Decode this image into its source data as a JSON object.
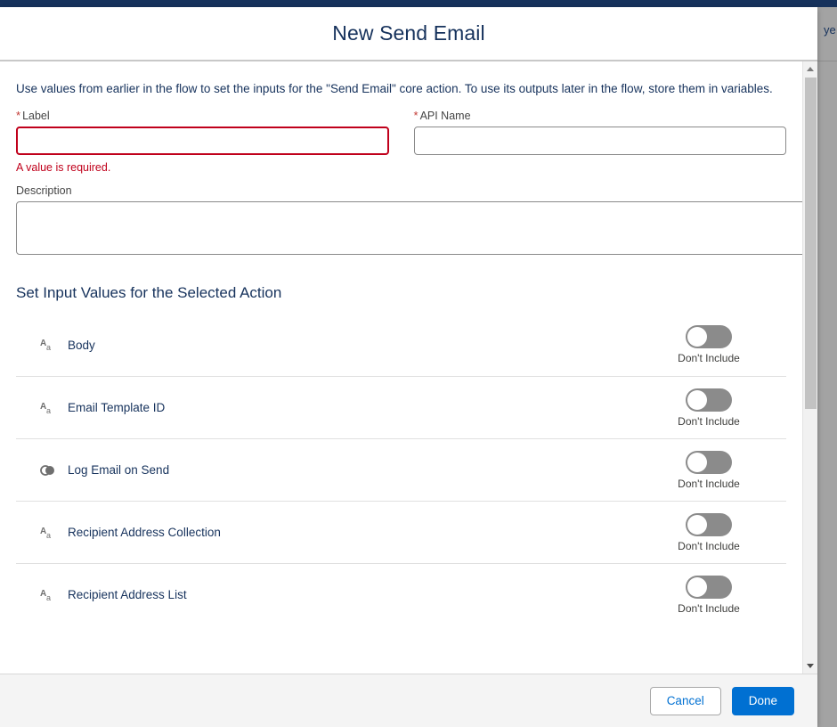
{
  "background": {
    "partial_text": "ye",
    "top_bar_color": "#16325c"
  },
  "modal": {
    "title": "New Send Email",
    "intro": "Use values from earlier in the flow to set the inputs for the \"Send Email\" core action. To use its outputs later in the flow, store them in variables.",
    "fields": {
      "label": {
        "label": "Label",
        "required_marker": "*",
        "value": "",
        "placeholder": "",
        "error": "A value is required.",
        "has_error": true
      },
      "api_name": {
        "label": "API Name",
        "required_marker": "*",
        "value": "",
        "placeholder": "",
        "has_error": false
      },
      "description": {
        "label": "Description",
        "value": "",
        "placeholder": ""
      }
    },
    "section_heading": "Set Input Values for the Selected Action",
    "input_rows": [
      {
        "name": "Body",
        "icon": "text-datatype-icon",
        "toggle_state": "off",
        "toggle_label": "Don't Include"
      },
      {
        "name": "Email Template ID",
        "icon": "text-datatype-icon",
        "toggle_state": "off",
        "toggle_label": "Don't Include"
      },
      {
        "name": "Log Email on Send",
        "icon": "boolean-datatype-icon",
        "toggle_state": "off",
        "toggle_label": "Don't Include"
      },
      {
        "name": "Recipient Address Collection",
        "icon": "text-datatype-icon",
        "toggle_state": "off",
        "toggle_label": "Don't Include"
      },
      {
        "name": "Recipient Address List",
        "icon": "text-datatype-icon",
        "toggle_state": "off",
        "toggle_label": "Don't Include"
      }
    ],
    "footer": {
      "cancel_label": "Cancel",
      "done_label": "Done"
    },
    "scrollbar": {
      "up_arrow": "chevron-up-icon",
      "down_arrow": "chevron-down-icon"
    }
  },
  "colors": {
    "brand_blue": "#0070d2",
    "header_navy": "#16325c",
    "error_red": "#c0001b",
    "toggle_off_gray": "#8b8b8b"
  }
}
